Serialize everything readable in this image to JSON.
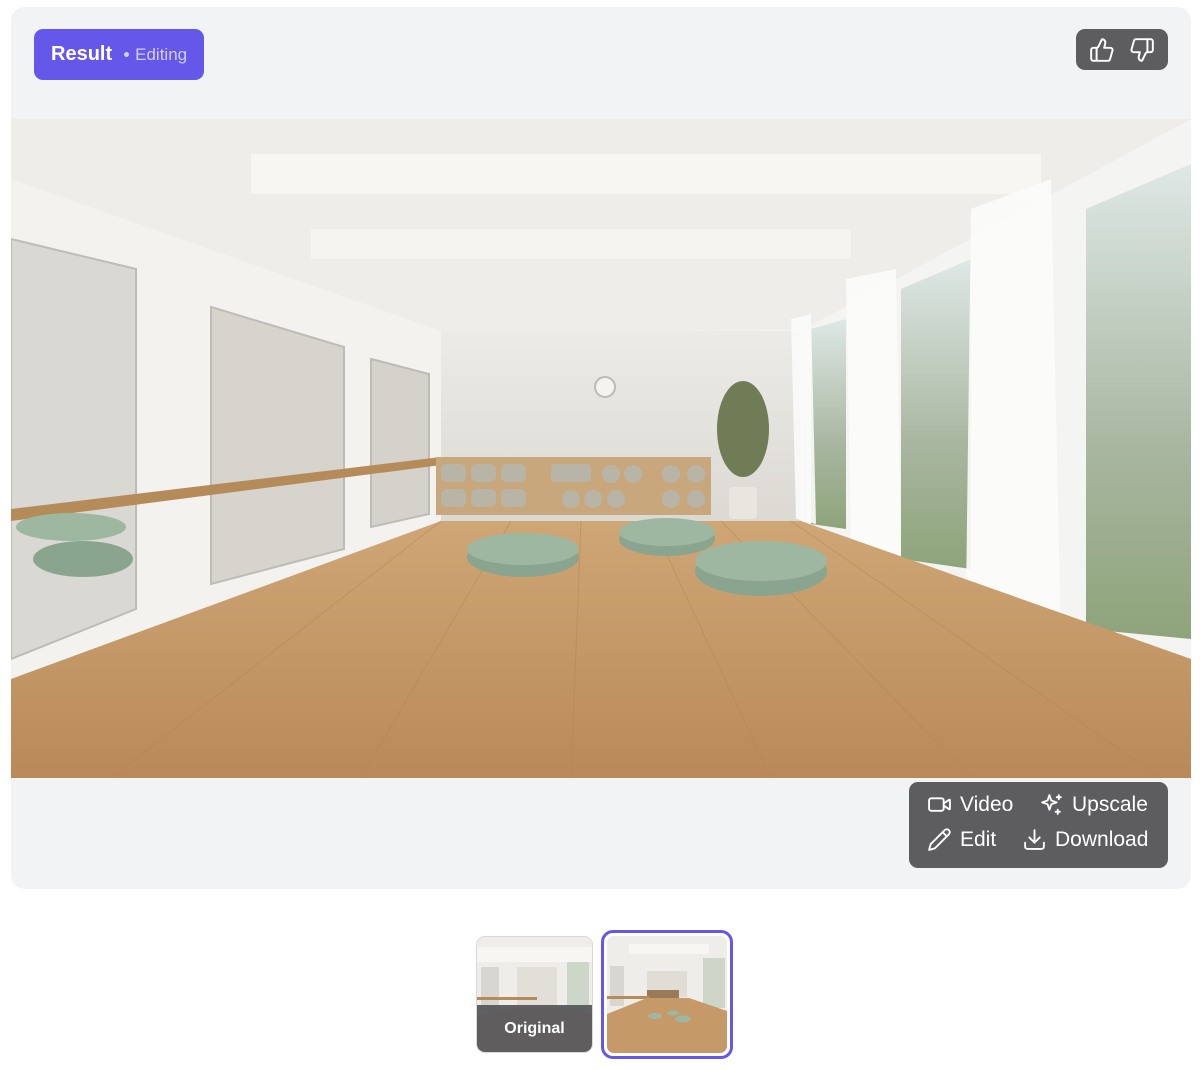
{
  "header": {
    "result_label": "Result",
    "status_label": "Editing"
  },
  "feedback": {
    "like_icon": "thumbs-up-icon",
    "dislike_icon": "thumbs-down-icon"
  },
  "actions": {
    "video_label": "Video",
    "upscale_label": "Upscale",
    "edit_label": "Edit",
    "download_label": "Download"
  },
  "thumbnails": {
    "original_label": "Original"
  },
  "colors": {
    "accent": "#6457ea",
    "panel": "#5d5d60",
    "card_bg": "#f2f3f5"
  }
}
